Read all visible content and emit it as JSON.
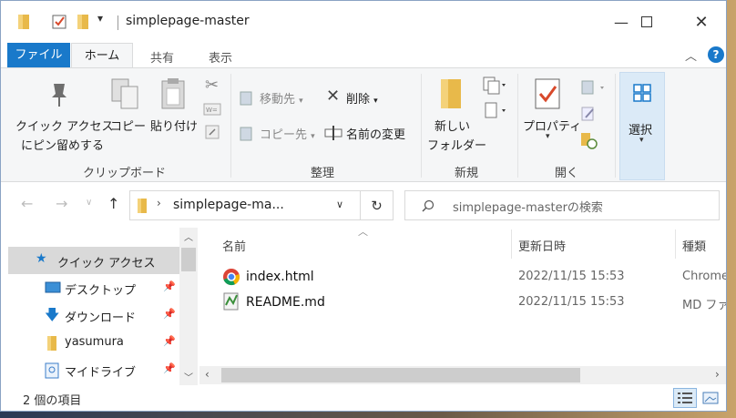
{
  "window": {
    "title": "simplepage-master"
  },
  "ribbon_tabs": {
    "file": "ファイル",
    "home": "ホーム",
    "share": "共有",
    "view": "表示"
  },
  "ribbon": {
    "clipboard": {
      "pin_quick_access": "クイック アクセス",
      "pin_quick_access_2": "にピン留めする",
      "copy": "コピー",
      "paste": "貼り付け",
      "group_label": "クリップボード"
    },
    "organize": {
      "move_to": "移動先",
      "copy_to": "コピー先",
      "delete": "削除",
      "rename": "名前の変更",
      "group_label": "整理"
    },
    "new": {
      "new_folder": "新しい",
      "new_folder_2": "フォルダー",
      "group_label": "新規"
    },
    "open": {
      "properties": "プロパティ",
      "group_label": "開く"
    },
    "select": {
      "label": "選択"
    }
  },
  "address_bar": {
    "path": "simplepage-ma...",
    "search_placeholder": "simplepage-masterの検索"
  },
  "nav_pane": {
    "items": [
      {
        "label": "クイック アクセス"
      },
      {
        "label": "デスクトップ"
      },
      {
        "label": "ダウンロード"
      },
      {
        "label": "yasumura"
      },
      {
        "label": "マイドライブ"
      }
    ]
  },
  "file_list": {
    "columns": [
      "名前",
      "更新日時",
      "種類"
    ],
    "rows": [
      {
        "name": "index.html",
        "modified": "2022/11/15 15:53",
        "type": "Chrome"
      },
      {
        "name": "README.md",
        "modified": "2022/11/15 15:53",
        "type": "MD ファ"
      }
    ]
  },
  "status_bar": {
    "item_count": "2 個の項目"
  },
  "colors": {
    "accent": "#1979ca",
    "selection": "#dbeaf7",
    "ribbon_bg": "#f5f6f7"
  }
}
